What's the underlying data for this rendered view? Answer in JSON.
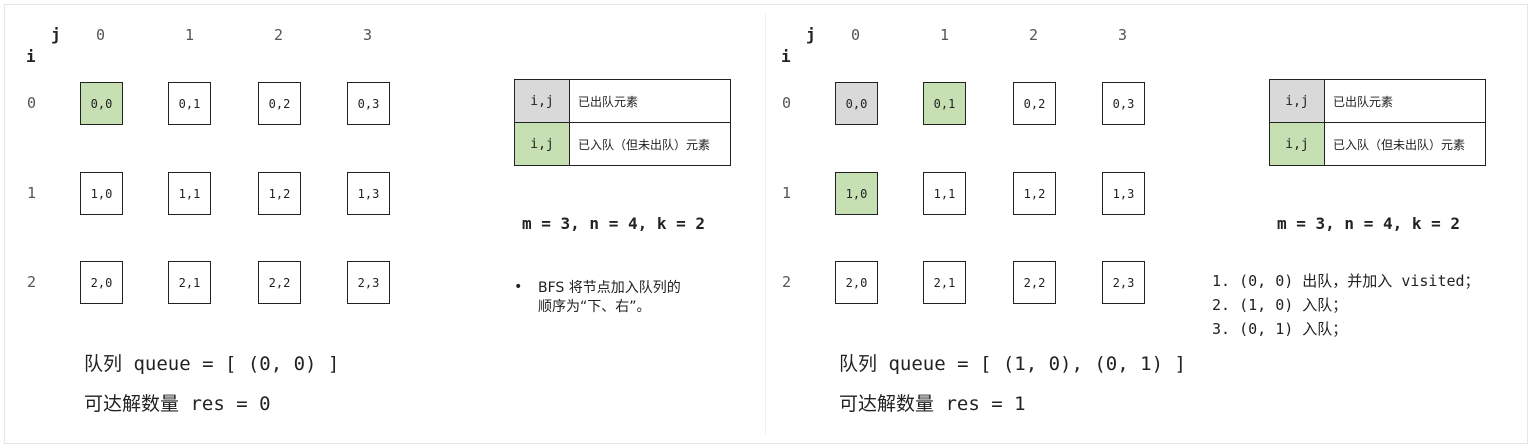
{
  "panels": [
    {
      "axis": {
        "j": "j",
        "i": "i"
      },
      "cols": [
        "0",
        "1",
        "2",
        "3"
      ],
      "rows": [
        "0",
        "1",
        "2"
      ],
      "cells": [
        [
          {
            "label": "0,0",
            "state": "queued"
          },
          {
            "label": "0,1",
            "state": "empty"
          },
          {
            "label": "0,2",
            "state": "empty"
          },
          {
            "label": "0,3",
            "state": "empty"
          }
        ],
        [
          {
            "label": "1,0",
            "state": "empty"
          },
          {
            "label": "1,1",
            "state": "empty"
          },
          {
            "label": "1,2",
            "state": "empty"
          },
          {
            "label": "1,3",
            "state": "empty"
          }
        ],
        [
          {
            "label": "2,0",
            "state": "empty"
          },
          {
            "label": "2,1",
            "state": "empty"
          },
          {
            "label": "2,2",
            "state": "empty"
          },
          {
            "label": "2,3",
            "state": "empty"
          }
        ]
      ],
      "legend": [
        {
          "swatch": "i,j",
          "desc": "已出队元素",
          "state": "visited"
        },
        {
          "swatch": "i,j",
          "desc": "已入队（但未出队）元素",
          "state": "queued"
        }
      ],
      "params": "m = 3, n = 4, k = 2",
      "bullet": "•",
      "note_line1": "BFS 将节点加入队列的",
      "note_line2": "顺序为“下、右”。",
      "queue_label": "队列",
      "queue_value": "queue = [ (0, 0) ]",
      "res_label": "可达解数量",
      "res_value": "res = 0"
    },
    {
      "axis": {
        "j": "j",
        "i": "i"
      },
      "cols": [
        "0",
        "1",
        "2",
        "3"
      ],
      "rows": [
        "0",
        "1",
        "2"
      ],
      "cells": [
        [
          {
            "label": "0,0",
            "state": "visited"
          },
          {
            "label": "0,1",
            "state": "queued"
          },
          {
            "label": "0,2",
            "state": "empty"
          },
          {
            "label": "0,3",
            "state": "empty"
          }
        ],
        [
          {
            "label": "1,0",
            "state": "queued"
          },
          {
            "label": "1,1",
            "state": "empty"
          },
          {
            "label": "1,2",
            "state": "empty"
          },
          {
            "label": "1,3",
            "state": "empty"
          }
        ],
        [
          {
            "label": "2,0",
            "state": "empty"
          },
          {
            "label": "2,1",
            "state": "empty"
          },
          {
            "label": "2,2",
            "state": "empty"
          },
          {
            "label": "2,3",
            "state": "empty"
          }
        ]
      ],
      "legend": [
        {
          "swatch": "i,j",
          "desc": "已出队元素",
          "state": "visited"
        },
        {
          "swatch": "i,j",
          "desc": "已入队（但未出队）元素",
          "state": "queued"
        }
      ],
      "params": "m = 3, n = 4, k = 2",
      "steps": [
        "1. (0, 0) 出队，并加入 visited；",
        "2. (1, 0) 入队；",
        "3. (0, 1) 入队；"
      ],
      "queue_label": "队列",
      "queue_value": "queue = [ (1, 0), (0, 1) ]",
      "res_label": "可达解数量",
      "res_value": "res = 1"
    }
  ],
  "colors": {
    "visited": "#d9d9d9",
    "queued": "#c6e0b4",
    "border": "#222222"
  }
}
